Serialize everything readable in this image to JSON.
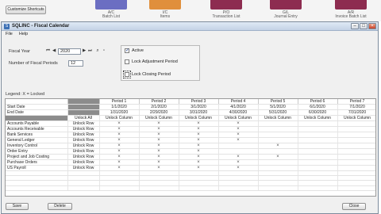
{
  "launcher": {
    "customize_label": "Customize Shortcuts",
    "items": [
      {
        "label": "A/C\nBatch List",
        "color": "#6b6ec2"
      },
      {
        "label": "I/C\nItems",
        "color": "#e08f3c"
      },
      {
        "label": "P/O\nTransaction List",
        "color": "#8d2c50"
      },
      {
        "label": "G/L\nJournal Entry",
        "color": "#8d2c50"
      },
      {
        "label": "A/R\nInvoice Batch List",
        "color": "#8d2c50"
      }
    ]
  },
  "window": {
    "title": "SQLINC - Fiscal Calendar",
    "menu": [
      "File",
      "Help"
    ]
  },
  "form": {
    "fiscal_year_label": "Fiscal Year",
    "fiscal_year_value": "2020",
    "num_periods_label": "Number of Fiscal Periods",
    "num_periods_value": "12",
    "options": [
      {
        "label": "Active",
        "checked": true
      },
      {
        "label": "Lock Adjustment Period",
        "checked": false
      },
      {
        "label": "Lock Closing Period",
        "checked": false
      }
    ]
  },
  "legend": "Legend: X = Locked",
  "grid": {
    "periods": [
      "Period 1",
      "Period 2",
      "Period 3",
      "Period 4",
      "Period 5",
      "Period 6",
      "Period 7"
    ],
    "start_label": "Start Date",
    "start_dates": [
      "1/1/2020",
      "2/1/2020",
      "3/1/2020",
      "4/1/2020",
      "5/1/2020",
      "6/1/2020",
      "7/1/2020"
    ],
    "end_label": "End Date",
    "end_dates": [
      "1/31/2020",
      "2/29/2020",
      "3/31/2020",
      "4/30/2020",
      "5/31/2020",
      "6/30/2020",
      "7/31/2020"
    ],
    "unlock_all": "Unlock All",
    "unlock_column": "Unlock Column",
    "unlock_row": "Unlock Row",
    "modules": [
      {
        "name": "Accounts Payable",
        "locks": [
          true,
          true,
          true,
          true,
          false,
          false,
          false
        ]
      },
      {
        "name": "Accounts Receivable",
        "locks": [
          true,
          true,
          true,
          true,
          false,
          false,
          false
        ]
      },
      {
        "name": "Bank Services",
        "locks": [
          true,
          true,
          true,
          true,
          false,
          false,
          false
        ]
      },
      {
        "name": "General Ledger",
        "locks": [
          true,
          true,
          true,
          true,
          false,
          false,
          false
        ]
      },
      {
        "name": "Inventory Control",
        "locks": [
          true,
          true,
          true,
          false,
          true,
          false,
          false
        ]
      },
      {
        "name": "Order Entry",
        "locks": [
          true,
          true,
          true,
          false,
          false,
          false,
          false
        ]
      },
      {
        "name": "Project and Job Costing",
        "locks": [
          true,
          true,
          true,
          true,
          true,
          false,
          false
        ]
      },
      {
        "name": "Purchase Orders",
        "locks": [
          true,
          true,
          true,
          true,
          false,
          false,
          false
        ]
      },
      {
        "name": "US Payroll",
        "locks": [
          true,
          true,
          true,
          true,
          false,
          false,
          false
        ]
      }
    ],
    "lock_mark": "×"
  },
  "buttons": {
    "save": "Save",
    "delete": "Delete",
    "close": "Close"
  }
}
